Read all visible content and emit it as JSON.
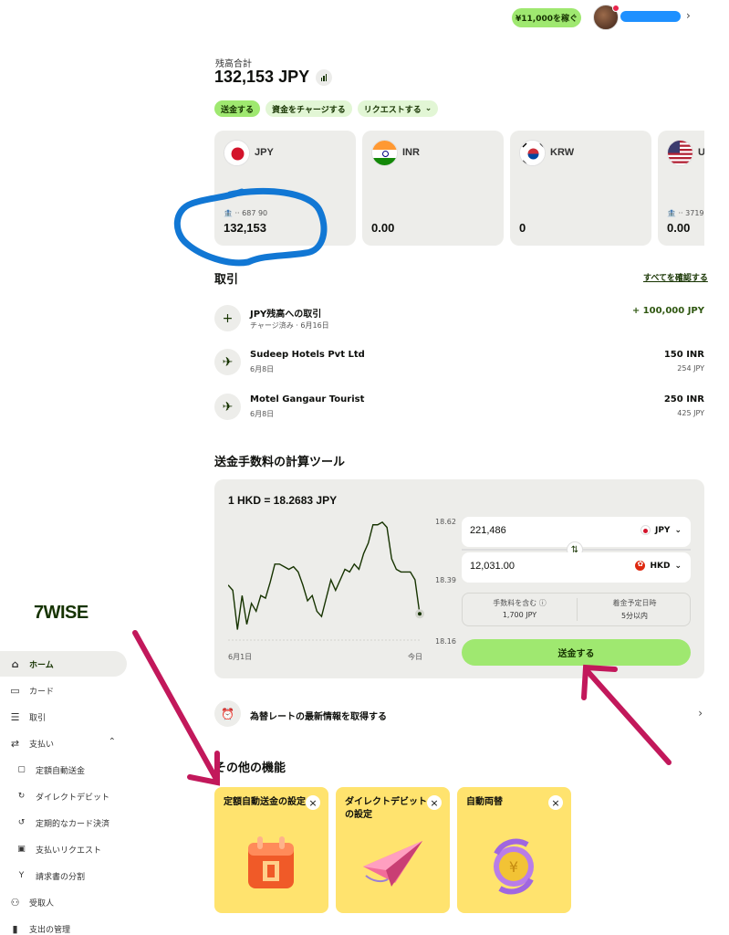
{
  "topbar": {
    "earn_label": "¥11,000を稼ぐ"
  },
  "balance": {
    "label": "残高合計",
    "total": "132,153 JPY"
  },
  "actions": {
    "send": "送金する",
    "add_money": "資金をチャージする",
    "request": "リクエストする"
  },
  "currency_cards": [
    {
      "code": "JPY",
      "account": "·· 687 90",
      "amount": "132,153"
    },
    {
      "code": "INR",
      "account": "",
      "amount": "0.00"
    },
    {
      "code": "KRW",
      "account": "",
      "amount": "0"
    },
    {
      "code": "U",
      "account": "·· 3719",
      "amount": "0.00"
    }
  ],
  "transactions": {
    "title": "取引",
    "see_all": "すべてを確認する",
    "items": [
      {
        "icon": "plus-icon",
        "title": "JPY残高への取引",
        "subtitle": "チャージ済み · 6月16日",
        "amount": "+ 100,000 JPY",
        "amount2": ""
      },
      {
        "icon": "travel-icon",
        "title": "Sudeep Hotels Pvt Ltd",
        "subtitle": "6月8日",
        "amount": "150 INR",
        "amount2": "254 JPY"
      },
      {
        "icon": "travel-icon",
        "title": "Motel Gangaur Tourist",
        "subtitle": "6月8日",
        "amount": "250 INR",
        "amount2": "425 JPY"
      }
    ]
  },
  "calculator": {
    "title": "送金手数料の計算ツール",
    "rate": "1 HKD = 18.2683 JPY",
    "y_ticks": [
      "18.62",
      "18.39",
      "18.16"
    ],
    "x_start": "6月1日",
    "x_end": "今日",
    "send_amount": "221,486",
    "send_currency": "JPY",
    "receive_amount": "12,031.00",
    "receive_currency": "HKD",
    "fee_label": "手数料を含む",
    "fee_value": "1,700 JPY",
    "eta_label": "着金予定日時",
    "eta_value": "5分以内",
    "send_button": "送金する"
  },
  "chart_data": {
    "type": "line",
    "title": "1 HKD = 18.2683 JPY",
    "xlabel": "",
    "ylabel": "",
    "x_ticks": [
      "6月1日",
      "今日"
    ],
    "ylim": [
      18.16,
      18.62
    ],
    "series": [
      {
        "values": [
          18.37,
          18.35,
          18.2,
          18.33,
          18.22,
          18.3,
          18.27,
          18.33,
          18.32,
          18.38,
          18.45,
          18.45,
          18.44,
          18.43,
          18.44,
          18.42,
          18.37,
          18.31,
          18.33,
          18.27,
          18.25,
          18.32,
          18.39,
          18.35,
          18.39,
          18.43,
          18.42,
          18.45,
          18.43,
          18.49,
          18.53,
          18.6,
          18.6,
          18.61,
          18.59,
          18.47,
          18.43,
          18.42,
          18.42,
          18.42,
          18.39,
          18.26
        ]
      }
    ]
  },
  "rate_alert": {
    "label": "為替レートの最新情報を取得する"
  },
  "features": {
    "title": "その他の機能",
    "cards": [
      {
        "title": "定額自動送金の設定",
        "art": "calendar-icon"
      },
      {
        "title": "ダイレクトデビットの設定",
        "art": "paper-plane-icon"
      },
      {
        "title": "自動両替",
        "art": "exchange-icon"
      }
    ]
  },
  "sidebar": {
    "logo": "7WISE",
    "items": [
      {
        "label": "ホーム",
        "icon": "home-icon",
        "active": true
      },
      {
        "label": "カード",
        "icon": "card-icon"
      },
      {
        "label": "取引",
        "icon": "list-icon"
      },
      {
        "label": "支払い",
        "icon": "payments-icon"
      },
      {
        "label": "定額自動送金",
        "icon": "calendar-icon",
        "sub": true
      },
      {
        "label": "ダイレクトデビット",
        "icon": "refresh-icon",
        "sub": true
      },
      {
        "label": "定期的なカード決済",
        "icon": "recurring-icon",
        "sub": true
      },
      {
        "label": "支払いリクエスト",
        "icon": "request-icon",
        "sub": true
      },
      {
        "label": "請求書の分割",
        "icon": "split-icon",
        "sub": true
      },
      {
        "label": "受取人",
        "icon": "recipients-icon"
      },
      {
        "label": "支出の管理",
        "icon": "insights-icon"
      }
    ]
  },
  "colors": {
    "accent": "#9fe870",
    "forest": "#163300",
    "annotation_blue": "#1177d4",
    "annotation_magenta": "#c2185b",
    "feature_yellow": "#ffe36e"
  }
}
